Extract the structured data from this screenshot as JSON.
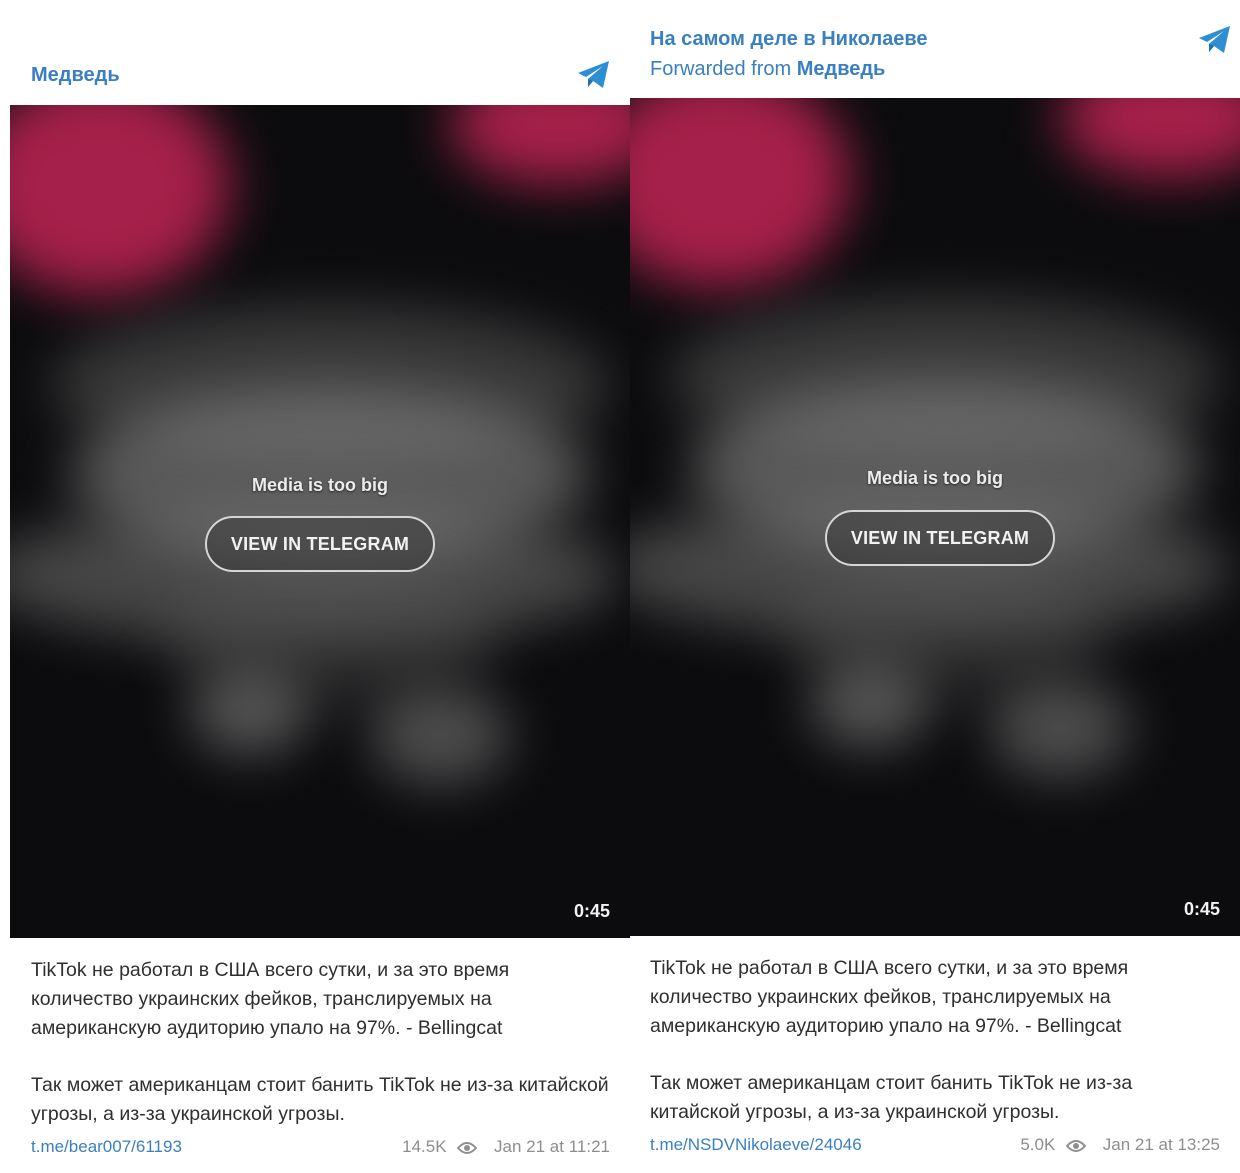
{
  "left_post": {
    "channel_name": "Медведь",
    "media_notice": "Media is too big",
    "view_button": "VIEW IN TELEGRAM",
    "duration": "0:45",
    "text_p1": "TikTok не работал в США всего сутки, и за это время количество украинских фейков, транслируемых на американскую аудиторию упало на 97%. - Bellingcat",
    "text_p2": "Так может американцам стоит банить TikTok не из-за китайской угрозы, а из-за украинской угрозы.",
    "link": "t.me/bear007/61193",
    "views": "14.5K",
    "date": "Jan 21 at 11:21"
  },
  "right_post": {
    "channel_name": "На самом деле в Николаеве",
    "forwarded_prefix": "Forwarded from",
    "forwarded_source": "Медведь",
    "media_notice": "Media is too big",
    "view_button": "VIEW IN TELEGRAM",
    "duration": "0:45",
    "text_p1": "TikTok не работал в США всего сутки, и за это время количество украинских фейков, транслируемых на американскую аудиторию упало на 97%. - Bellingcat",
    "text_p2": "Так может американцам стоит банить TikTok не из-за китайской угрозы, а из-за украинской угрозы.",
    "link": "t.me/NSDVNikolaeve/24046",
    "views": "5.0K",
    "date": "Jan 21 at 13:25"
  },
  "icons": {
    "telegram": "telegram-icon",
    "views": "eye-icon"
  },
  "colors": {
    "accent": "#3a7fc0",
    "media_bg": "#0c0c0e",
    "blur_pink": "#a5204a",
    "muted_text": "#8e8e8e"
  }
}
